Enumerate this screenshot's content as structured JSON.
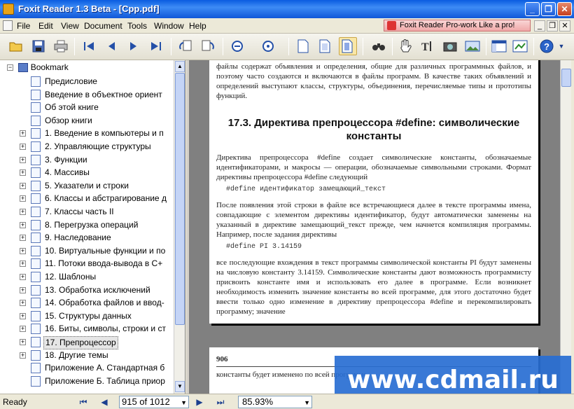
{
  "window": {
    "title": "Foxit Reader 1.3 Beta - [Cpp.pdf]",
    "minimize": "_",
    "restore": "❐",
    "close": "✕"
  },
  "menubar": {
    "items": [
      "File",
      "Edit",
      "View",
      "Document",
      "Tools",
      "Window",
      "Help"
    ],
    "ad_banner": "Foxit Reader Pro-work Like a pro!",
    "mdi_minimize": "_",
    "mdi_restore": "❐",
    "mdi_close": "✕"
  },
  "toolbar": {
    "icons": [
      "open-icon",
      "save-icon",
      "print-icon",
      "first-page-icon",
      "prev-page-icon",
      "next-page-icon",
      "last-page-icon",
      "rotate-left-icon",
      "rotate-right-icon",
      "zoom-out-icon",
      "zoom-in-icon",
      "single-page-icon",
      "continuous-icon",
      "facing-icon",
      "find-icon",
      "hand-icon",
      "text-select-icon",
      "snapshot-icon",
      "image-icon",
      "view-icon",
      "bookmark-panel-icon",
      "help-icon"
    ]
  },
  "bookmarks": {
    "root": "Bookmark",
    "items": [
      {
        "label": "Предисловие",
        "expandable": false
      },
      {
        "label": "Введение в объектное ориент",
        "expandable": false
      },
      {
        "label": "Об этой книге",
        "expandable": false
      },
      {
        "label": "Обзор книги",
        "expandable": false
      },
      {
        "label": "1. Введение в компьютеры и п",
        "expandable": true
      },
      {
        "label": "2. Управляющие структуры",
        "expandable": true
      },
      {
        "label": "3. Функции",
        "expandable": true
      },
      {
        "label": "4. Массивы",
        "expandable": true
      },
      {
        "label": "5. Указатели и строки",
        "expandable": true
      },
      {
        "label": "6. Классы и абстрагирование д",
        "expandable": true
      },
      {
        "label": "7. Классы часть II",
        "expandable": true
      },
      {
        "label": "8. Перегрузка операций",
        "expandable": true
      },
      {
        "label": "9. Наследование",
        "expandable": true
      },
      {
        "label": "10. Виртуальные функции и по",
        "expandable": true
      },
      {
        "label": "11. Потоки ввода-вывода в C+",
        "expandable": true
      },
      {
        "label": "12. Шаблоны",
        "expandable": true
      },
      {
        "label": "13. Обработка исключений",
        "expandable": true
      },
      {
        "label": "14. Обработка файлов и ввод-",
        "expandable": true
      },
      {
        "label": "15. Структуры данных",
        "expandable": true
      },
      {
        "label": "16. Биты, символы, строки и ст",
        "expandable": true
      },
      {
        "label": "17. Препроцессор",
        "expandable": true,
        "selected": true
      },
      {
        "label": "18. Другие темы",
        "expandable": true
      },
      {
        "label": "Приложение А. Стандартная б",
        "expandable": false
      },
      {
        "label": "Приложение Б. Таблица приор",
        "expandable": false
      }
    ]
  },
  "document": {
    "page1_para1": "файлы содержат объявления и определения, общие для различных программных файлов, и поэтому часто создаются и включаются в файлы программ. В качестве таких объявлений и определений выступают классы, структуры, объединения, перечисляемые типы и прототипы функций.",
    "heading": "17.3. Директива препроцессора #define: символические константы",
    "page1_para2": "Директива препроцессора #define создает символические константы, обозначаемые идентификаторами, и макросы — операции, обозначаемые символьными строками. Формат директивы препроцессора #define следующий",
    "code1": "#define идентификатор замещающий_текст",
    "page1_para3": "После появления этой строки в файле все встречающиеся далее в тексте программы имена, совпадающие с элементом директивы идентификатор, будут автоматически заменены на указанный в директиве замещающий_текст прежде, чем начнется компиляция программы. Например, после задания директивы",
    "code2": "#define PI 3.14159",
    "page1_para4": "все последующие вхождения в текст программы символической константы PI будут заменены на числовую константу 3.14159. Символические константы дают возможность программисту присвоить константе имя и использовать его далее в программе. Если возникнет необходимость изменить значение константы во всей программе, для этого достаточно будет ввести только одно изменение в директиву препроцессора #define и перекомпилировать программу; значение",
    "page2_number": "906",
    "page2_text": "константы будет изменено по всей программе."
  },
  "watermark": "www.cdmail.ru",
  "statusbar": {
    "status": "Ready",
    "page_indicator": "915 of 1012",
    "zoom": "85.93%"
  }
}
